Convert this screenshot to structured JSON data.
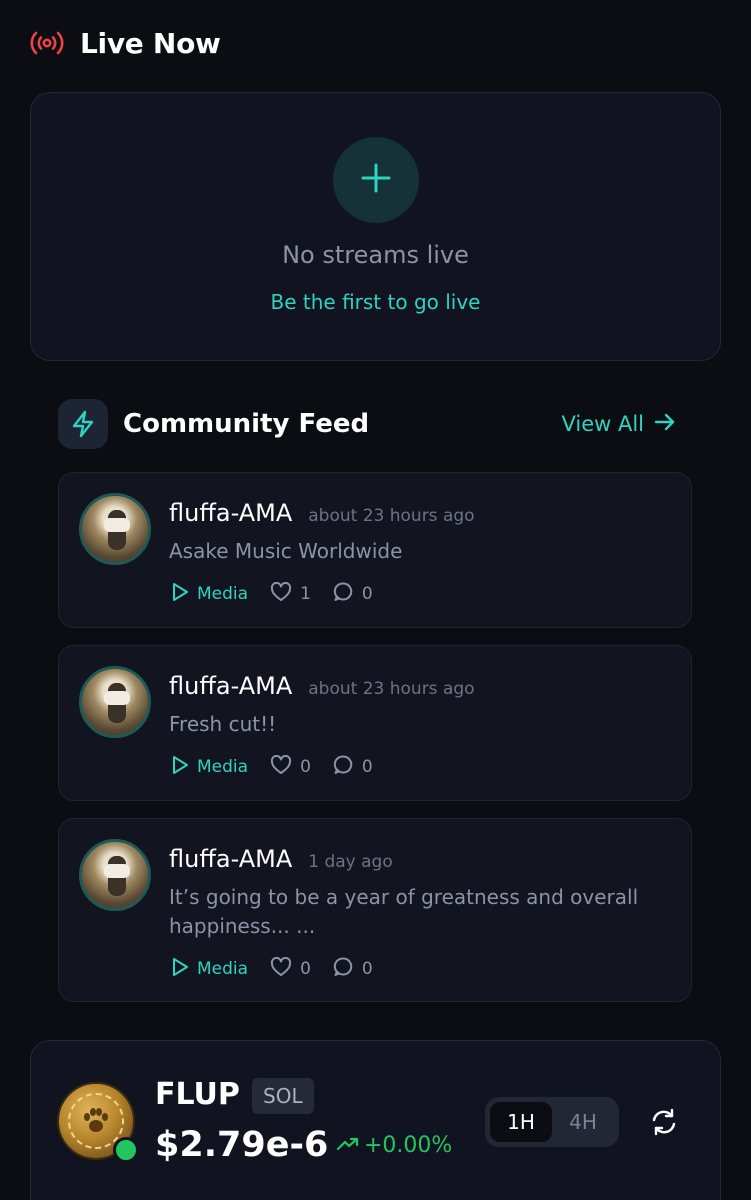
{
  "live": {
    "title": "Live Now",
    "empty_text": "No streams live",
    "cta_label": "Be the first to go live"
  },
  "feed": {
    "title": "Community Feed",
    "view_all_label": "View All",
    "posts": [
      {
        "username": "fluffa-AMA",
        "time": "about 23 hours ago",
        "text": "Asake Music Worldwide",
        "media_label": "Media",
        "likes": "1",
        "comments": "0"
      },
      {
        "username": "fluffa-AMA",
        "time": "about 23 hours ago",
        "text": "Fresh cut!!",
        "media_label": "Media",
        "likes": "0",
        "comments": "0"
      },
      {
        "username": "fluffa-AMA",
        "time": "1 day ago",
        "text": "It’s going to be a year of greatness and overall happiness... ...",
        "media_label": "Media",
        "likes": "0",
        "comments": "0"
      }
    ]
  },
  "token": {
    "ticker": "FLUP",
    "chain": "SOL",
    "price": "$2.79e-6",
    "change": "+0.00%",
    "timeframes": [
      "1H",
      "4H"
    ],
    "active_timeframe": "1H"
  },
  "colors": {
    "accent": "#2dd4bf",
    "live_red": "#ef4444",
    "positive": "#22c55e",
    "background": "#0b0d12"
  },
  "icons": {
    "live": "broadcast-icon",
    "add": "plus-icon",
    "feed": "lightning-icon",
    "view_all": "arrow-right-icon",
    "media": "play-icon",
    "likes": "heart-icon",
    "comments": "comment-icon",
    "change": "trend-up-icon",
    "refresh": "refresh-icon"
  }
}
